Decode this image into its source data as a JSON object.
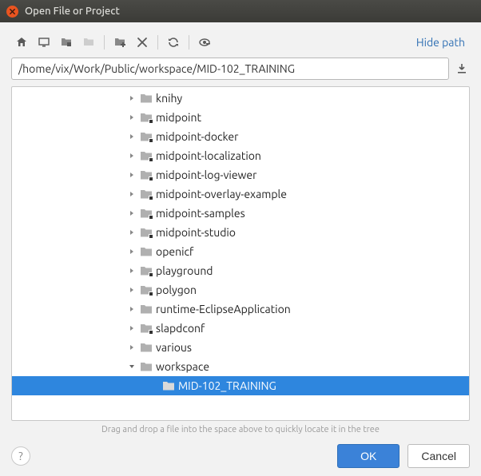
{
  "window": {
    "title": "Open File or Project"
  },
  "toolbar": {
    "hide_path_label": "Hide path"
  },
  "path": {
    "value": "/home/vix/Work/Public/workspace/MID-102_TRAINING"
  },
  "tree": {
    "items": [
      {
        "label": "knihy",
        "git": false,
        "expanded": false,
        "depth": 0
      },
      {
        "label": "midpoint",
        "git": true,
        "expanded": false,
        "depth": 0
      },
      {
        "label": "midpoint-docker",
        "git": true,
        "expanded": false,
        "depth": 0
      },
      {
        "label": "midpoint-localization",
        "git": true,
        "expanded": false,
        "depth": 0
      },
      {
        "label": "midpoint-log-viewer",
        "git": true,
        "expanded": false,
        "depth": 0
      },
      {
        "label": "midpoint-overlay-example",
        "git": true,
        "expanded": false,
        "depth": 0
      },
      {
        "label": "midpoint-samples",
        "git": true,
        "expanded": false,
        "depth": 0
      },
      {
        "label": "midpoint-studio",
        "git": true,
        "expanded": false,
        "depth": 0
      },
      {
        "label": "openicf",
        "git": false,
        "expanded": false,
        "depth": 0
      },
      {
        "label": "playground",
        "git": true,
        "expanded": false,
        "depth": 0
      },
      {
        "label": "polygon",
        "git": true,
        "expanded": false,
        "depth": 0
      },
      {
        "label": "runtime-EclipseApplication",
        "git": false,
        "expanded": false,
        "depth": 0
      },
      {
        "label": "slapdconf",
        "git": true,
        "expanded": false,
        "depth": 0
      },
      {
        "label": "various",
        "git": false,
        "expanded": false,
        "depth": 0
      },
      {
        "label": "workspace",
        "git": false,
        "expanded": true,
        "depth": 0
      },
      {
        "label": "MID-102_TRAINING",
        "git": false,
        "expanded": null,
        "depth": 1,
        "selected": true
      }
    ]
  },
  "hint": "Drag and drop a file into the space above to quickly locate it in the tree",
  "buttons": {
    "ok": "OK",
    "cancel": "Cancel"
  }
}
